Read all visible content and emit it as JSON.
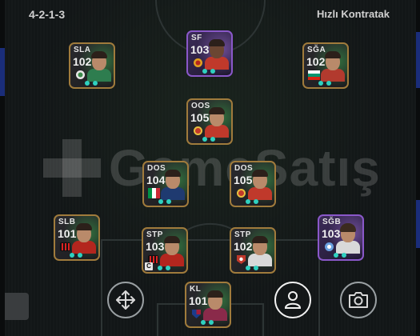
{
  "header": {
    "formation": "4-2-1-3",
    "quick_contract": "Hızlı Kontratak"
  },
  "watermark": {
    "text": "GameSatış"
  },
  "players": [
    {
      "pos": "SLA",
      "rating": "102",
      "frame": "gold",
      "badge": "club-crest-icon",
      "shirt": "#2e7d4f"
    },
    {
      "pos": "SF",
      "rating": "103",
      "frame": "purple",
      "badge": "galatasaray-crest-icon",
      "shirt": "#c0392b"
    },
    {
      "pos": "SĞA",
      "rating": "102",
      "frame": "gold",
      "badge": "bulgaria-flag-icon",
      "shirt": "#b23a2e"
    },
    {
      "pos": "OOS",
      "rating": "105",
      "frame": "gold",
      "badge": "manchester-united-crest-icon",
      "shirt": "#c0392b"
    },
    {
      "pos": "DOS",
      "rating": "104",
      "frame": "gold",
      "badge": "italy-flag-icon",
      "shirt": "#1f3a70"
    },
    {
      "pos": "DOS",
      "rating": "105",
      "frame": "gold",
      "badge": "manchester-united-crest-icon",
      "shirt": "#c0392b"
    },
    {
      "pos": "SLB",
      "rating": "101",
      "frame": "gold",
      "badge": "ac-milan-crest-icon",
      "shirt": "#b3261e"
    },
    {
      "pos": "STP",
      "rating": "103",
      "frame": "gold",
      "badge": "ac-milan-crest-icon",
      "shirt": "#b3261e",
      "captain": "C"
    },
    {
      "pos": "STP",
      "rating": "102",
      "frame": "gold",
      "badge": "league-badge-icon",
      "shirt": "#d9d9d9"
    },
    {
      "pos": "SĞB",
      "rating": "103",
      "frame": "purple",
      "badge": "club-crest-icon",
      "shirt": "#d9d9d9"
    },
    {
      "pos": "KL",
      "rating": "101",
      "frame": "gold",
      "badge": "barcelona-crest-icon",
      "shirt": "#8a2a4a"
    }
  ],
  "controls": [
    {
      "name": "move-button",
      "icon": "move-arrows-icon"
    },
    {
      "name": "player-button",
      "icon": "person-icon"
    },
    {
      "name": "screenshot-button",
      "icon": "camera-icon"
    }
  ]
}
